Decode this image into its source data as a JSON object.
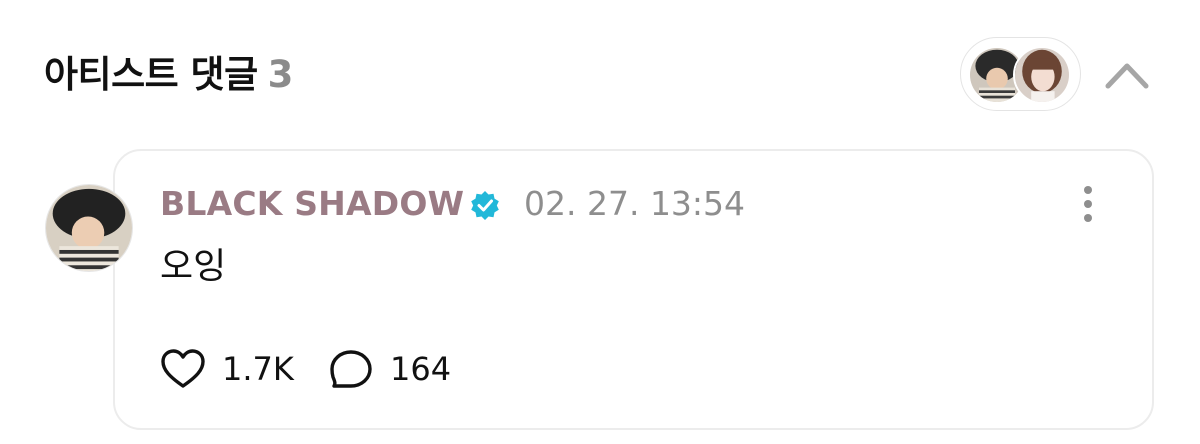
{
  "header": {
    "title": "아티스트 댓글",
    "count": "3"
  },
  "comment": {
    "author": "BLACK SHADOW",
    "timestamp": "02. 27. 13:54",
    "text": "오잉",
    "likes": "1.7K",
    "replies": "164"
  },
  "colors": {
    "author": "#9a7b84",
    "verified": "#22b8d9",
    "muted": "#8e8e8e"
  },
  "icons": [
    "chevron-up-icon",
    "verified-badge-icon",
    "more-vertical-icon",
    "heart-icon",
    "comment-bubble-icon"
  ]
}
